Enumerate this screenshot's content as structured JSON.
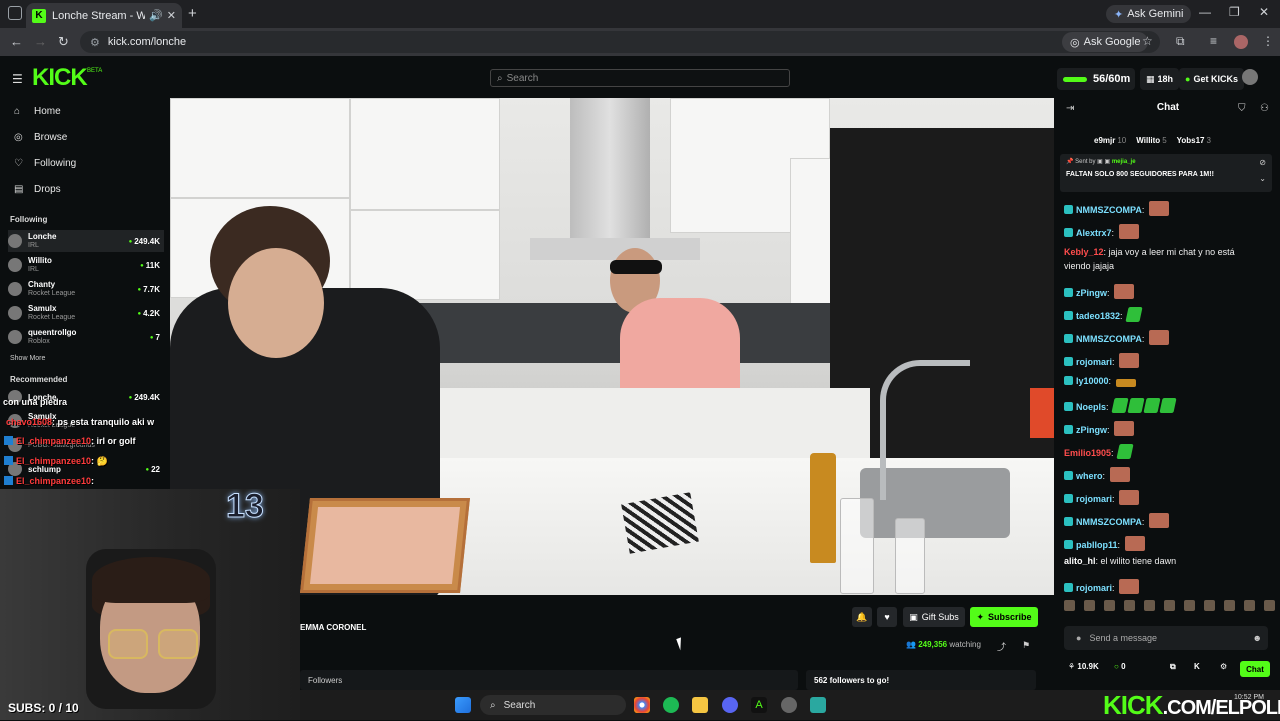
{
  "browser": {
    "tab_title": "Lonche Stream - Watch Live",
    "tab_favicon": "K",
    "ask_gemini": "Ask Gemini",
    "url": "kick.com/lonche",
    "ask_google": "Ask Google"
  },
  "kick": {
    "logo": "KICK",
    "beta": "BETA",
    "search_placeholder": "Search",
    "kick_timer": "56/60m",
    "watch_time": "18h",
    "get_kicks": "Get KICKs",
    "accent": "#53fc18"
  },
  "sidebar": {
    "nav": [
      {
        "label": "Home",
        "icon": "home-icon"
      },
      {
        "label": "Browse",
        "icon": "compass-icon"
      },
      {
        "label": "Following",
        "icon": "heart-icon"
      },
      {
        "label": "Drops",
        "icon": "gift-icon"
      }
    ],
    "following_header": "Following",
    "following": [
      {
        "name": "Lonche",
        "category": "IRL",
        "viewers": "249.4K"
      },
      {
        "name": "Willito",
        "category": "IRL",
        "viewers": "11K"
      },
      {
        "name": "Chanty",
        "category": "Rocket League",
        "viewers": "7.7K"
      },
      {
        "name": "Samulx",
        "category": "Rocket League",
        "viewers": "4.2K"
      },
      {
        "name": "queentrollgo",
        "category": "Roblox",
        "viewers": "7"
      }
    ],
    "show_more": "Show More",
    "recommended_header": "Recommended",
    "recommended": [
      {
        "name": "Lonche",
        "category": "",
        "viewers": "249.4K"
      },
      {
        "name": "Samulx",
        "category": "Rocket League",
        "viewers": ""
      },
      {
        "name": "",
        "category": "PUBG: Battlegrounds",
        "viewers": ""
      },
      {
        "name": "schlump",
        "category": "",
        "viewers": "22"
      }
    ]
  },
  "overlay_chat": [
    {
      "text": "con una piedra",
      "user": ""
    },
    {
      "user": "chavo1608",
      "text": ": ps esta tranquilo aki w"
    },
    {
      "user": "El_chimpanzee10",
      "text": ": irl or golf"
    },
    {
      "user": "El_chimpanzee10",
      "text": ": 🤔"
    },
    {
      "user": "El_chimpanzee10",
      "text": ":"
    }
  ],
  "webcam": {
    "counter": "13",
    "subs": "SUBS: 0 / 10"
  },
  "stream": {
    "streamer_label": "EMMA CORONEL",
    "gift_subs": "Gift Subs",
    "subscribe": "Subscribe",
    "viewers": "249,356",
    "watching": "watching",
    "followers_tab": "Followers",
    "followers_goal": "562 followers to go!"
  },
  "chat": {
    "title": "Chat",
    "gifters": [
      {
        "name": "e9mjr",
        "count": "10"
      },
      {
        "name": "Willito",
        "count": "5"
      },
      {
        "name": "Yobs17",
        "count": "3"
      }
    ],
    "pinned_by_label": "Sent by",
    "pinned_by_user": "mejia_je",
    "pinned_message": "FALTAN SOLO 800 SEGUIDORES PARA 1M!!",
    "messages": [
      {
        "user": "NMMSZCOMPA",
        "text": "",
        "color": "#53fc18",
        "emote": "face"
      },
      {
        "user": "Alextrx7",
        "text": "",
        "color": "#53fc18",
        "emote": "face"
      },
      {
        "user": "Kebly_12",
        "text": "jaja voy a leer mi chat y no está",
        "text2": "viendo jajaja",
        "color": "#ff4d4d",
        "emote": ""
      },
      {
        "user": "zPingw",
        "text": "",
        "color": "#53fc18",
        "emote": "face"
      },
      {
        "user": "tadeo1832",
        "text": "",
        "color": "#53fc18",
        "emote": "green"
      },
      {
        "user": "NMMSZCOMPA",
        "text": "",
        "color": "#53fc18",
        "emote": "face"
      },
      {
        "user": "rojomari",
        "text": "",
        "color": "#53fc18",
        "emote": "face"
      },
      {
        "user": "ly10000",
        "text": "",
        "color": "#53fc18",
        "emote": "wide"
      },
      {
        "user": "Noepls",
        "text": "",
        "color": "#53fc18",
        "emote": "green4"
      },
      {
        "user": "zPingw",
        "text": "",
        "color": "#53fc18",
        "emote": "face"
      },
      {
        "user": "Emilio1905",
        "text": "",
        "color": "#ff4d4d",
        "emote": "green"
      },
      {
        "user": "whero",
        "text": "",
        "color": "#53fc18",
        "emote": "face"
      },
      {
        "user": "rojomari",
        "text": "",
        "color": "#53fc18",
        "emote": "face"
      },
      {
        "user": "NMMSZCOMPA",
        "text": "",
        "color": "#53fc18",
        "emote": "face"
      },
      {
        "user": "pabllop11",
        "text": "",
        "color": "#53fc18",
        "emote": "face"
      },
      {
        "user": "alito_hl",
        "text": "el wilito tiene dawn",
        "color": "#ffffff",
        "emote": ""
      },
      {
        "user": "rojomari",
        "text": "",
        "color": "#53fc18",
        "emote": "face"
      }
    ],
    "send_placeholder": "Send a message",
    "kicks": "10.9K",
    "points": "0",
    "chat_button": "Chat"
  },
  "taskbar": {
    "search": "Search",
    "clock": "10:52 PM"
  },
  "watermark": {
    "brand": "KICK",
    "handle": ".COM/ELPOLIN"
  }
}
